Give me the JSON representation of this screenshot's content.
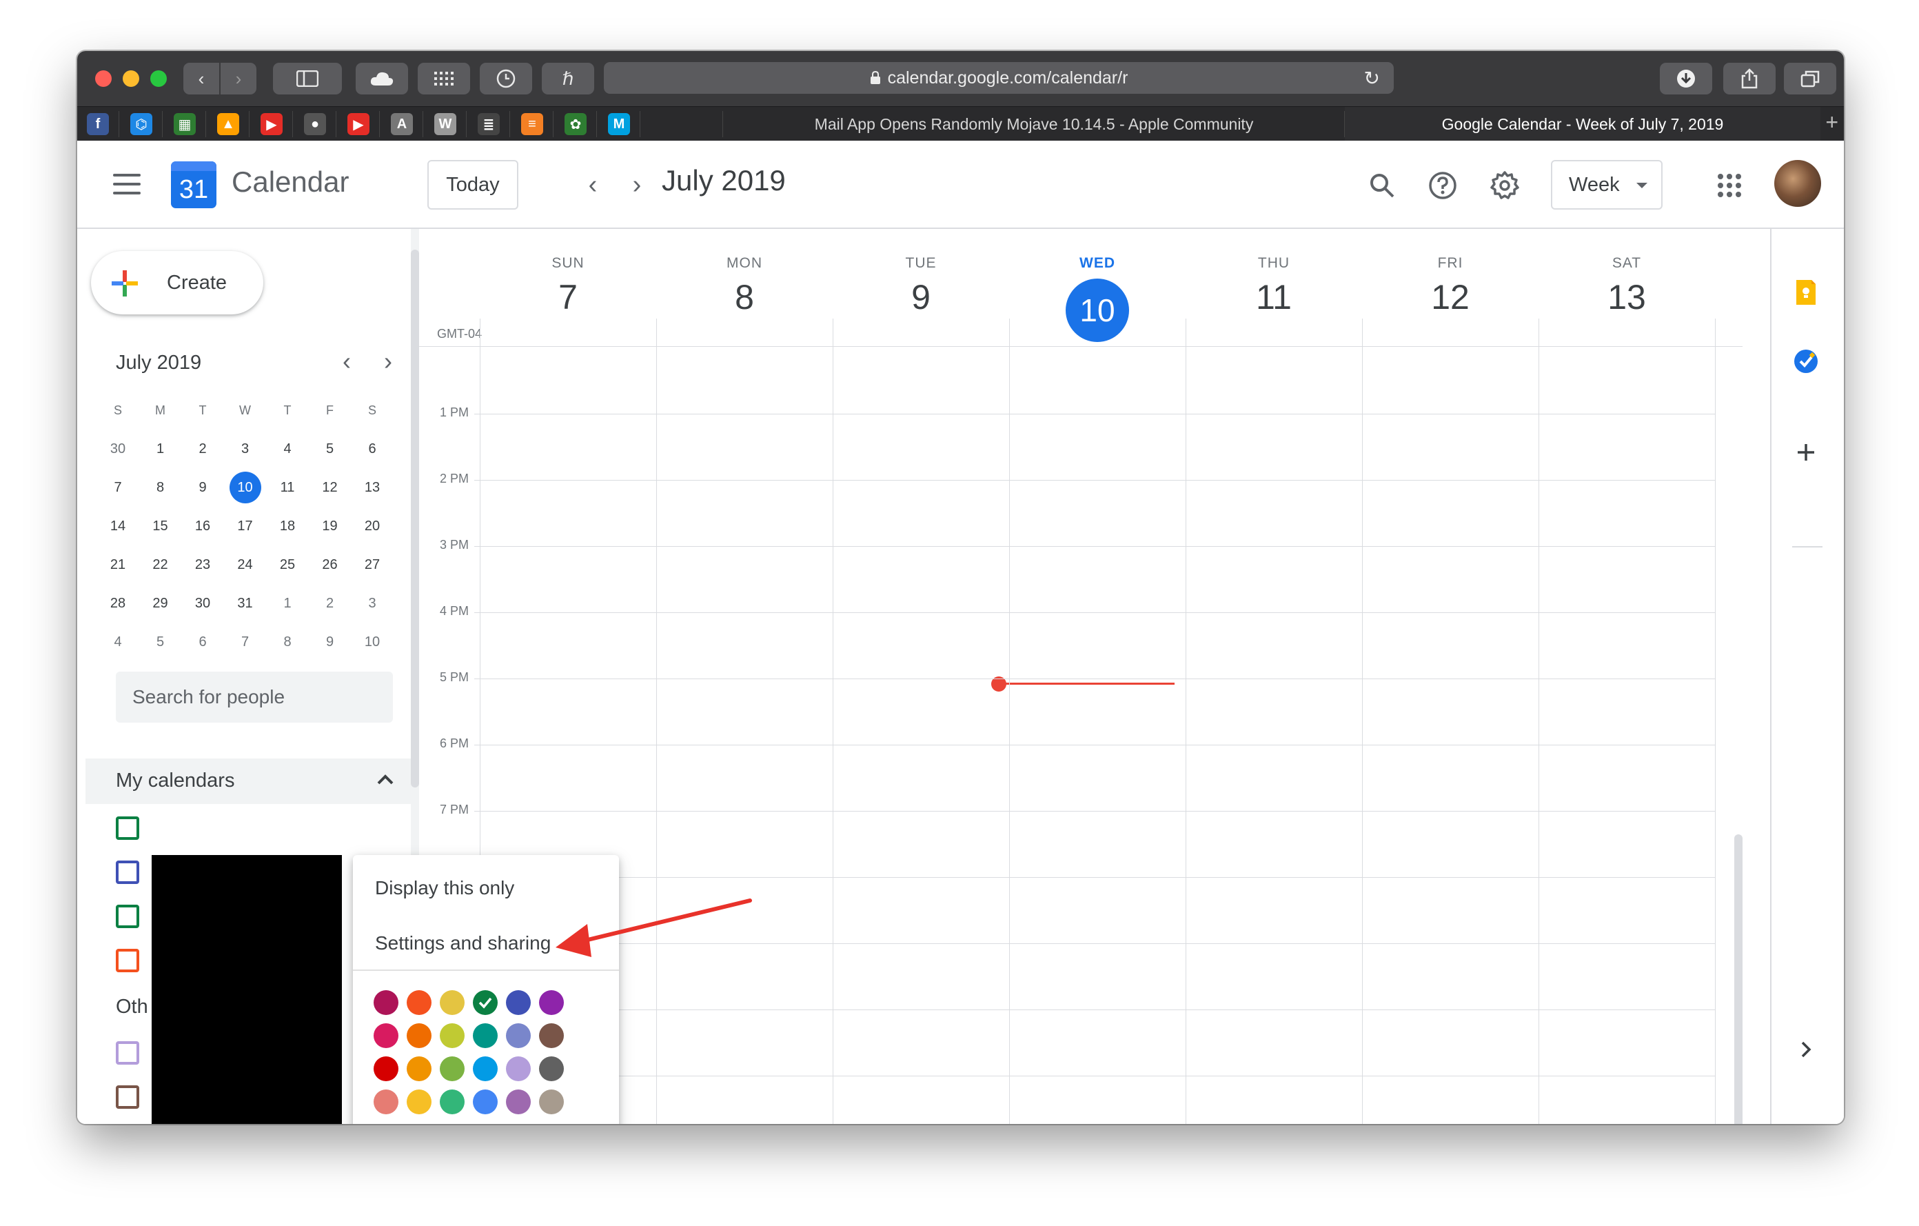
{
  "browser": {
    "url": "calendar.google.com/calendar/r",
    "tabs": [
      {
        "title": "Mail App Opens Randomly Mojave 10.14.5 - Apple Community",
        "active": false
      },
      {
        "title": "Google Calendar - Week of July 7, 2019",
        "active": true
      }
    ],
    "favorites": [
      {
        "icon": "facebook-icon",
        "letter": "f",
        "color": "#3b5998"
      },
      {
        "icon": "app-icon",
        "letter": "⌬",
        "color": "#1e88e5"
      },
      {
        "icon": "grid-app-icon",
        "letter": "▦",
        "color": "#2e7d32"
      },
      {
        "icon": "firebase-icon",
        "letter": "▲",
        "color": "#ffa000"
      },
      {
        "icon": "youtube-icon",
        "letter": "▶",
        "color": "#e52d27"
      },
      {
        "icon": "apple-icon",
        "letter": "●",
        "color": "#555555"
      },
      {
        "icon": "youtube-icon",
        "letter": "▶",
        "color": "#e52d27"
      },
      {
        "icon": "a-app-icon",
        "letter": "A",
        "color": "#777777"
      },
      {
        "icon": "w-app-icon",
        "letter": "W",
        "color": "#999999"
      },
      {
        "icon": "doc-app-icon",
        "letter": "≣",
        "color": "#444444"
      },
      {
        "icon": "stackoverflow-icon",
        "letter": "≡",
        "color": "#f48024"
      },
      {
        "icon": "leaf-app-icon",
        "letter": "✿",
        "color": "#2e7d32"
      },
      {
        "icon": "m-app-icon",
        "letter": "M",
        "color": "#00a1e0"
      }
    ]
  },
  "header": {
    "app_name": "Calendar",
    "logo_number": "31",
    "today_label": "Today",
    "month_label": "July 2019",
    "view_label": "Week"
  },
  "sidebar": {
    "create_label": "Create",
    "mini_month": "July 2019",
    "dow": [
      "S",
      "M",
      "T",
      "W",
      "T",
      "F",
      "S"
    ],
    "weeks": [
      [
        "30",
        "1",
        "2",
        "3",
        "4",
        "5",
        "6"
      ],
      [
        "7",
        "8",
        "9",
        "10",
        "11",
        "12",
        "13"
      ],
      [
        "14",
        "15",
        "16",
        "17",
        "18",
        "19",
        "20"
      ],
      [
        "21",
        "22",
        "23",
        "24",
        "25",
        "26",
        "27"
      ],
      [
        "28",
        "29",
        "30",
        "31",
        "1",
        "2",
        "3"
      ],
      [
        "4",
        "5",
        "6",
        "7",
        "8",
        "9",
        "10"
      ]
    ],
    "search_placeholder": "Search for people",
    "my_calendars_label": "My calendars",
    "other_label": "Oth",
    "my_calendar_colors": [
      "#0b8043",
      "#3f51b5",
      "#0b8043",
      "#f4511e"
    ],
    "other_calendar_colors": [
      "#b39ddb",
      "#795548"
    ]
  },
  "week": {
    "timezone": "GMT-04",
    "days": [
      {
        "dow": "SUN",
        "num": "7",
        "today": false
      },
      {
        "dow": "MON",
        "num": "8",
        "today": false
      },
      {
        "dow": "TUE",
        "num": "9",
        "today": false
      },
      {
        "dow": "WED",
        "num": "10",
        "today": true
      },
      {
        "dow": "THU",
        "num": "11",
        "today": false
      },
      {
        "dow": "FRI",
        "num": "12",
        "today": false
      },
      {
        "dow": "SAT",
        "num": "13",
        "today": false
      }
    ],
    "hours": [
      "1 PM",
      "2 PM",
      "3 PM",
      "4 PM",
      "5 PM",
      "6 PM",
      "7 PM"
    ]
  },
  "popup": {
    "items": [
      "Display this only",
      "Settings and sharing"
    ],
    "colors": [
      [
        "#ad1457",
        "#f4511e",
        "#e4c441",
        "#0b8043",
        "#3f51b5",
        "#8e24aa"
      ],
      [
        "#d81b60",
        "#ef6c00",
        "#c0ca33",
        "#009688",
        "#7986cb",
        "#795548"
      ],
      [
        "#d50000",
        "#f09300",
        "#7cb342",
        "#039be5",
        "#b39ddb",
        "#616161"
      ],
      [
        "#e67c73",
        "#f6bf26",
        "#33b679",
        "#4285f4",
        "#9e69af",
        "#a79b8e"
      ]
    ],
    "selected_color_index": [
      0,
      3
    ],
    "add_color_symbol": "+"
  },
  "colors": {
    "accent": "#1a73e8",
    "now_line": "#ea4335",
    "annotation_arrow": "#e8322a"
  }
}
